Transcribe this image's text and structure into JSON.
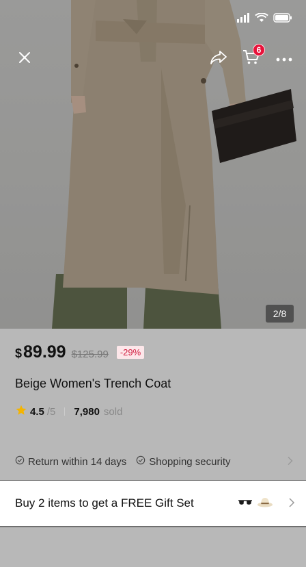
{
  "top_bar": {
    "close_icon": "close-icon",
    "share_icon": "share-icon",
    "cart_icon": "cart-icon",
    "cart_badge": "6",
    "more_icon": "more-icon"
  },
  "gallery": {
    "counter": "2/8"
  },
  "product": {
    "currency": "$",
    "price": "89.99",
    "original_price": "$125.99",
    "discount": "-29%",
    "title": "Beige Women's Trench Coat",
    "rating": "4.5",
    "rating_max": "/5",
    "sold_count": "7,980",
    "sold_label": "sold"
  },
  "services": {
    "items": [
      {
        "icon": "check-circle-icon",
        "label": "Return within 14 days"
      },
      {
        "icon": "check-circle-icon",
        "label": "Shopping security"
      }
    ]
  },
  "promo": {
    "text": "Buy 2 items to get a FREE Gift Set",
    "icons": [
      "sunglasses-icon",
      "hat-icon"
    ]
  },
  "colors": {
    "accent": "#e8123a",
    "discount_text": "#d11d3f",
    "star": "#f4b400"
  }
}
